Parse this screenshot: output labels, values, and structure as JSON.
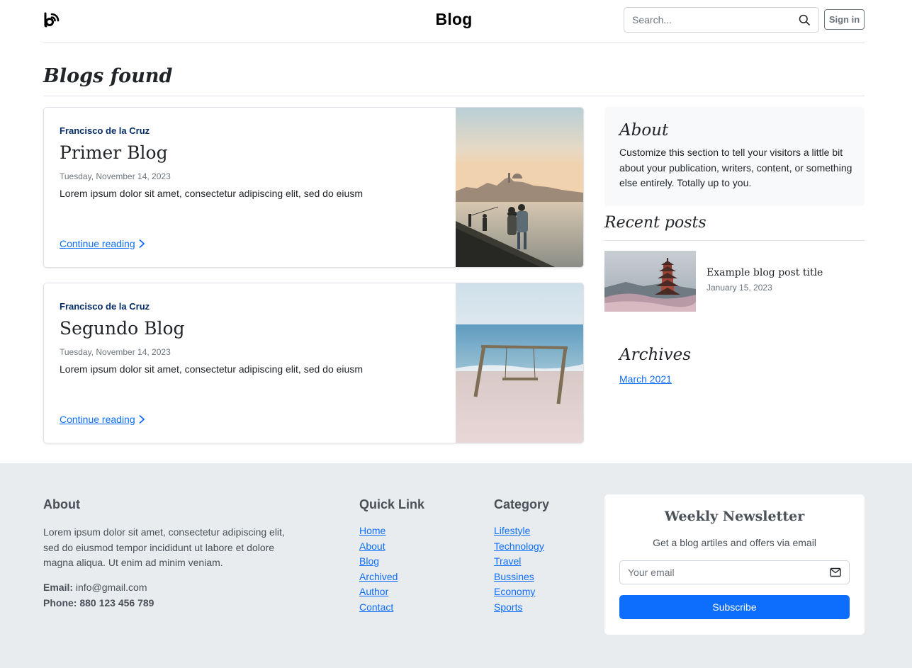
{
  "header": {
    "site_title": "Blog",
    "search_placeholder": "Search...",
    "signin_label": "Sign in"
  },
  "results": {
    "title": "Blogs found"
  },
  "posts": [
    {
      "author": "Francisco de la Cruz",
      "title": "Primer Blog",
      "date": "Tuesday, November 14, 2023",
      "excerpt": "Lorem ipsum dolor sit amet, consectetur adipiscing elit, sed do eiusm",
      "link_label": "Continue reading",
      "image": "harbor-sunset-photo"
    },
    {
      "author": "Francisco de la Cruz",
      "title": "Segundo Blog",
      "date": "Tuesday, November 14, 2023",
      "excerpt": "Lorem ipsum dolor sit amet, consectetur adipiscing elit, sed do eiusm",
      "link_label": "Continue reading",
      "image": "beach-swing-photo"
    }
  ],
  "sidebar": {
    "about_title": "About",
    "about_text": "Customize this section to tell your visitors a little bit about your publication, writers, content, or something else entirely. Totally up to you.",
    "recent_title": "Recent posts",
    "recent_posts": [
      {
        "title": "Example blog post title",
        "date": "January 15, 2023",
        "image": "pagoda-photo"
      }
    ],
    "archives_title": "Archives",
    "archives": [
      "March 2021"
    ]
  },
  "footer": {
    "about_title": "About",
    "about_text": "Lorem ipsum dolor sit amet, consectetur adipiscing elit, sed do eiusmod tempor incididunt ut labore et dolore magna aliqua. Ut enim ad minim veniam.",
    "email_label": "Email:",
    "email_value": "info@gmail.com",
    "phone_label": "Phone:",
    "phone_value": "880 123 456 789",
    "quicklink_title": "Quick Link",
    "quicklinks": [
      "Home",
      "About",
      "Blog",
      "Archived",
      "Author",
      "Contact"
    ],
    "category_title": "Category",
    "categories": [
      "Lifestyle",
      "Technology",
      "Travel",
      "Bussines",
      "Economy",
      "Sports"
    ],
    "newsletter": {
      "title": "Weekly Newsletter",
      "subtitle": "Get a blog artiles and offers via email",
      "email_placeholder": "Your email",
      "button_label": "Subscribe"
    }
  },
  "colors": {
    "link": "#0d6efd",
    "author": "#052c65",
    "footer_bg": "#e9ecef",
    "sidebar_bg": "#f8f9fa",
    "button": "#0d6efd"
  }
}
